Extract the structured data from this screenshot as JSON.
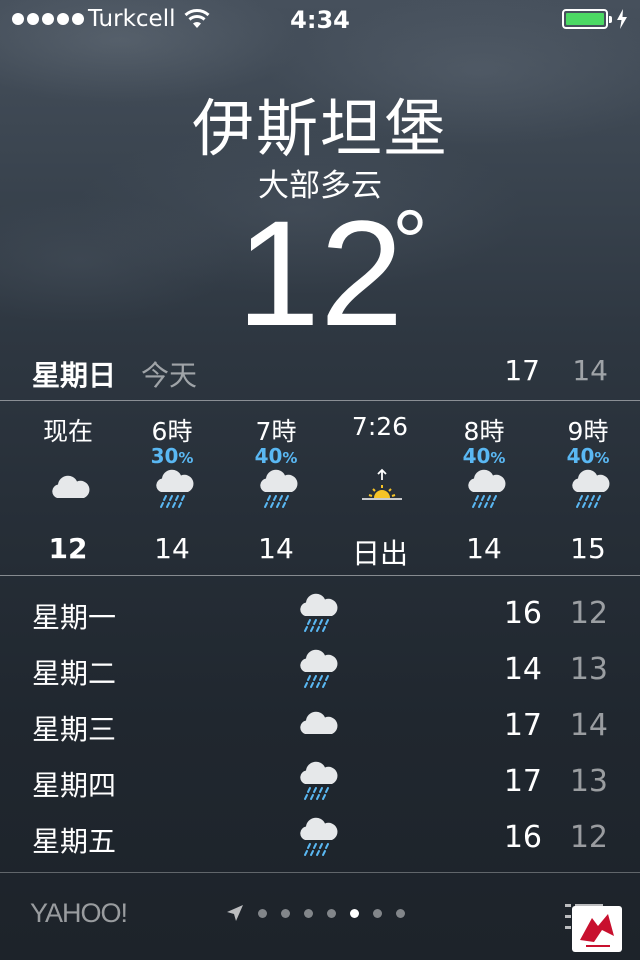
{
  "status_bar": {
    "carrier": "Turkcell",
    "time": "4:34",
    "battery_color": "#4cd964"
  },
  "weather": {
    "city": "伊斯坦堡",
    "condition": "大部多云",
    "temperature": "12",
    "degree_symbol": "°"
  },
  "today": {
    "day": "星期日",
    "label": "今天",
    "high": "17",
    "low": "14"
  },
  "hourly": [
    {
      "time": "现在",
      "precip": "",
      "icon": "cloud-icon",
      "value": "12"
    },
    {
      "time": "6時",
      "precip": "30",
      "icon": "rain-cloud-icon",
      "value": "14"
    },
    {
      "time": "7時",
      "precip": "40",
      "icon": "rain-cloud-icon",
      "value": "14"
    },
    {
      "time": "7:26",
      "precip": "",
      "icon": "sunrise-icon",
      "value": "日出"
    },
    {
      "time": "8時",
      "precip": "40",
      "icon": "rain-cloud-icon",
      "value": "14"
    },
    {
      "time": "9時",
      "precip": "40",
      "icon": "rain-cloud-icon",
      "value": "15"
    }
  ],
  "percent_sign": "%",
  "daily": [
    {
      "day": "星期一",
      "icon": "rain-cloud-icon",
      "high": "16",
      "low": "12"
    },
    {
      "day": "星期二",
      "icon": "rain-cloud-icon",
      "high": "14",
      "low": "13"
    },
    {
      "day": "星期三",
      "icon": "cloud-icon",
      "high": "17",
      "low": "14"
    },
    {
      "day": "星期四",
      "icon": "rain-cloud-icon",
      "high": "17",
      "low": "13"
    },
    {
      "day": "星期五",
      "icon": "rain-cloud-icon",
      "high": "16",
      "low": "12"
    }
  ],
  "footer": {
    "brand": "YAHOO!",
    "page_count": 7,
    "active_page": 5
  },
  "colors": {
    "precip_blue": "#5ab8f3",
    "sun_yellow": "#f7c427"
  }
}
